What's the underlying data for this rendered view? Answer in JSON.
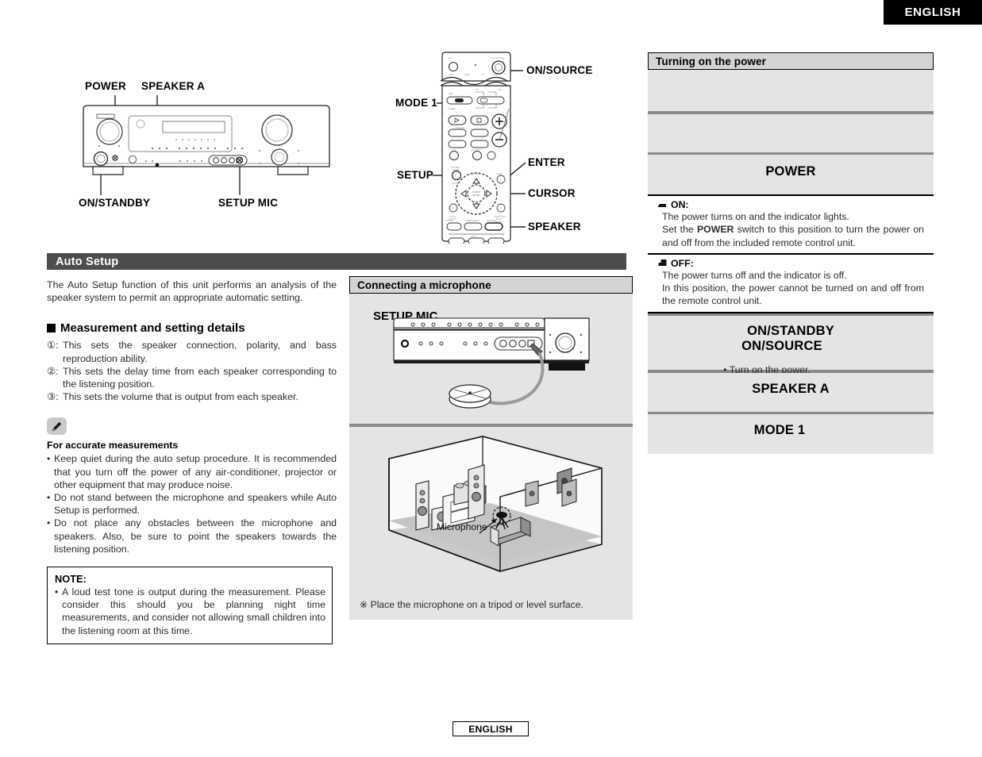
{
  "page": {
    "language_tab": "ENGLISH",
    "footer_language": "ENGLISH"
  },
  "front_panel_diagram": {
    "callouts": {
      "power": "POWER",
      "speaker_a": "SPEAKER A",
      "on_standby": "ON/STANDBY",
      "setup_mic": "SETUP MIC"
    }
  },
  "remote_diagram": {
    "callouts": {
      "on_source": "ON/SOURCE",
      "mode_1": "MODE 1",
      "setup": "SETUP",
      "enter": "ENTER",
      "cursor": "CURSOR",
      "speaker": "SPEAKER"
    }
  },
  "auto_setup": {
    "header": "Auto Setup",
    "intro": "The Auto Setup function of this unit performs an analysis of the speaker system to permit an appropriate automatic setting.",
    "measurement_heading": "Measurement and setting details",
    "measurement_items": [
      {
        "marker": "①:",
        "text": "This sets the speaker connection, polarity, and bass reproduction ability."
      },
      {
        "marker": "②:",
        "text": "This sets the delay time from each speaker corresponding to the listening position."
      },
      {
        "marker": "③:",
        "text": "This sets the volume that is output from each speaker."
      }
    ],
    "note_icon": "pencil-icon",
    "accurate_heading": "For accurate measurements",
    "accurate_bullets": [
      "Keep quiet during the auto setup procedure. It is recommended that you turn off the power of any air-conditioner, projector or other equipment that may produce noise.",
      "Do not stand between the microphone and speakers while Auto Setup is performed.",
      "Do not place any obstacles between the microphone and speakers. Also, be sure to point the speakers towards the listening position."
    ],
    "note_box": {
      "title": "NOTE:",
      "bullets": [
        "A loud test tone is output during the measurement. Please consider this should you be planning night time measurements, and consider not allowing small children into the listening room at this time."
      ]
    }
  },
  "connecting_microphone": {
    "header": "Connecting a microphone",
    "panel_label": "SETUP MIC",
    "room_label": "Microphone",
    "caption": "※ Place the microphone on a tripod or level surface."
  },
  "turning_on_power": {
    "header": "Turning on the power",
    "rows": [
      {
        "label": "",
        "note": ""
      },
      {
        "label": "",
        "note": ""
      },
      {
        "label": "POWER",
        "note": ""
      },
      {
        "label": "ON/STANDBY\nON/SOURCE",
        "note": "• Turn on the power."
      },
      {
        "label": "SPEAKER A",
        "note": ""
      },
      {
        "label": "MODE 1",
        "note": ""
      }
    ],
    "labels": {
      "power": "POWER",
      "on_standby": "ON/STANDBY",
      "on_source": "ON/SOURCE",
      "turn_on_note": "• Turn on the power.",
      "speaker_a": "SPEAKER A",
      "mode_1": "MODE 1"
    },
    "switch_on": {
      "title": "ON:",
      "line1": "The power turns on and the indicator lights.",
      "line2_a": "Set the ",
      "line2_bold": "POWER",
      "line2_b": " switch to this position to turn the power on and off from the included remote control unit."
    },
    "switch_off": {
      "title": "OFF:",
      "line1": "The power turns off and the indicator is off.",
      "line2": "In this position, the power cannot be turned on and off from the remote control unit."
    }
  },
  "colors": {
    "dark_bar": "#4d4d4d",
    "light_bar": "#d4d4d4",
    "panel_gray": "#e4e4e4",
    "divider_gray": "#8a8a8a",
    "black": "#000000"
  }
}
